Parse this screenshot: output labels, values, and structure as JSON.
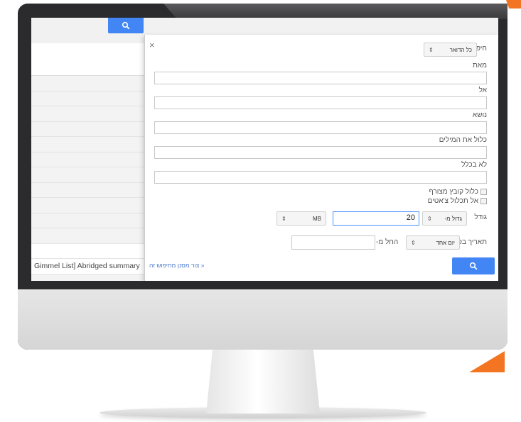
{
  "app": {
    "top_search_icon": "search-icon"
  },
  "mail_list": {
    "rows": [
      "",
      "",
      "",
      "",
      "",
      "",
      "",
      "",
      "",
      "",
      "",
      "",
      "Gimmel List] Abridged summary",
      "",
      ""
    ]
  },
  "search_dialog": {
    "close_label": "×",
    "search_in_label": "חיפוש",
    "search_in_value": "כל הדואר",
    "from_label": "מאת",
    "from_value": "",
    "to_label": "אל",
    "to_value": "",
    "subject_label": "נושא",
    "subject_value": "",
    "has_words_label": "כלול את המילים",
    "has_words_value": "",
    "doesnt_have_label": "לא בכלל",
    "doesnt_have_value": "",
    "has_attachment_label": "כלול קובץ מצורף",
    "no_chats_label": "אל תכלול צ'אטים",
    "size_label": "גודל",
    "size_op_value": "גדול מ-",
    "size_value": "20",
    "size_unit_value": "MB",
    "date_label": "תאריך בטווח",
    "date_range_value": "יום אחד",
    "date_of_label": "החל מ-",
    "date_value": "",
    "create_filter_link": "צור מסנן מחיפוש זה »",
    "submit_icon": "search-icon"
  },
  "colors": {
    "accent_blue": "#4285f4",
    "orange": "#f37521"
  }
}
